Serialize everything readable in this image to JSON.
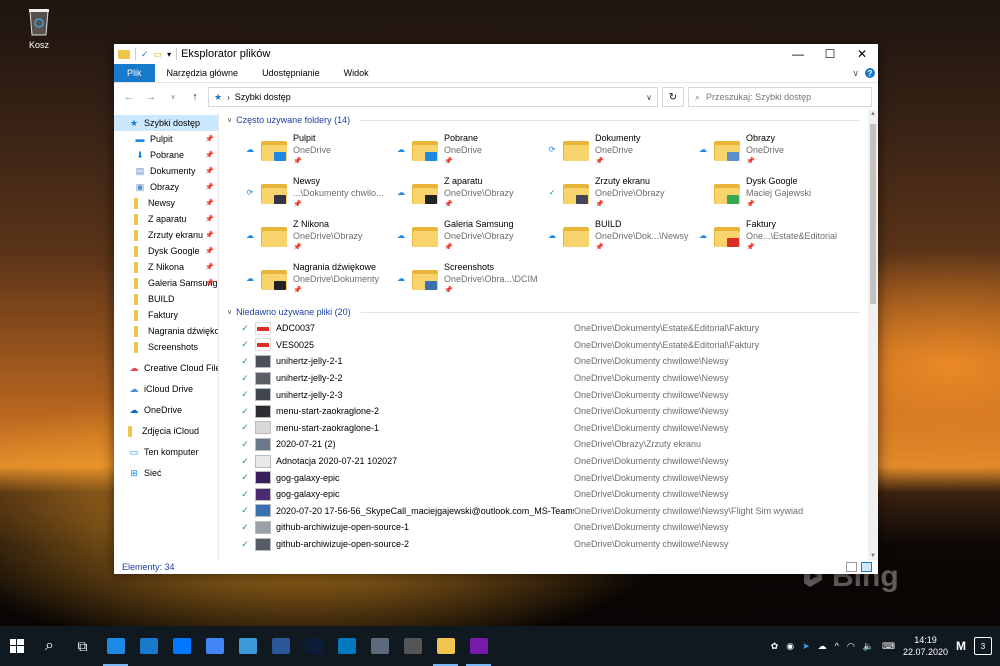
{
  "desktop": {
    "recycle_label": "Kosz",
    "watermark": "Bing"
  },
  "window": {
    "title": "Eksplorator plików",
    "ribbon_tabs": [
      "Plik",
      "Narzędzia główne",
      "Udostępnianie",
      "Widok"
    ],
    "address": "Szybki dostęp",
    "search_placeholder": "Przeszukaj: Szybki dostęp",
    "status_text": "Elementy: 34"
  },
  "nav": [
    {
      "label": "Szybki dostęp",
      "icon": "star-icon",
      "sel": true
    },
    {
      "label": "Pulpit",
      "icon": "desktop-icon",
      "pin": true
    },
    {
      "label": "Pobrane",
      "icon": "download-icon",
      "pin": true
    },
    {
      "label": "Dokumenty",
      "icon": "documents-icon",
      "pin": true
    },
    {
      "label": "Obrazy",
      "icon": "pictures-icon",
      "pin": true
    },
    {
      "label": "Newsy",
      "icon": "folder-icon",
      "pin": true
    },
    {
      "label": "Z aparatu",
      "icon": "folder-icon",
      "pin": true
    },
    {
      "label": "Zrzuty ekranu",
      "icon": "folder-icon",
      "pin": true
    },
    {
      "label": "Dysk Google",
      "icon": "folder-icon",
      "pin": true
    },
    {
      "label": "Z Nikona",
      "icon": "folder-icon",
      "pin": true
    },
    {
      "label": "Galeria Samsung",
      "icon": "folder-icon",
      "pin": true
    },
    {
      "label": "BUILD",
      "icon": "folder-icon"
    },
    {
      "label": "Faktury",
      "icon": "folder-icon"
    },
    {
      "label": "Nagrania dźwiękowe",
      "icon": "folder-icon"
    },
    {
      "label": "Screenshots",
      "icon": "folder-icon"
    },
    {
      "label": "Creative Cloud Files",
      "icon": "creative-cloud-icon",
      "top": true
    },
    {
      "label": "iCloud Drive",
      "icon": "icloud-icon",
      "top": true
    },
    {
      "label": "OneDrive",
      "icon": "onedrive-icon",
      "top": true
    },
    {
      "label": "Zdjęcia iCloud",
      "icon": "folder-icon",
      "top": true
    },
    {
      "label": "Ten komputer",
      "icon": "computer-icon",
      "top": true
    },
    {
      "label": "Sieć",
      "icon": "network-icon",
      "top": true
    }
  ],
  "frequent": {
    "header": "Często używane foldery (14)",
    "folders": [
      {
        "name": "Pulpit",
        "sub": "OneDrive",
        "status": "cloud",
        "badge": "#1e88e5"
      },
      {
        "name": "Pobrane",
        "sub": "OneDrive",
        "status": "cloud",
        "badge": "#1e88e5"
      },
      {
        "name": "Dokumenty",
        "sub": "OneDrive",
        "status": "sync",
        "badge": ""
      },
      {
        "name": "Obrazy",
        "sub": "OneDrive",
        "status": "cloud",
        "badge": "#5a8fc9"
      },
      {
        "name": "Newsy",
        "sub": "...\\Dokumenty chwilo...",
        "status": "sync",
        "badge": "#333344"
      },
      {
        "name": "Z aparatu",
        "sub": "OneDrive\\Obrazy",
        "status": "cloud",
        "badge": "#222222"
      },
      {
        "name": "Zrzuty ekranu",
        "sub": "OneDrive\\Obrazy",
        "status": "ok",
        "badge": "#444455"
      },
      {
        "name": "Dysk Google",
        "sub": "Maciej Gajewski",
        "status": "",
        "badge": "#34a853"
      },
      {
        "name": "Z Nikona",
        "sub": "OneDrive\\Obrazy",
        "status": "cloud",
        "badge": ""
      },
      {
        "name": "Galeria Samsung",
        "sub": "OneDrive\\Obrazy",
        "status": "cloud",
        "badge": ""
      },
      {
        "name": "BUILD",
        "sub": "OneDrive\\Dok...\\Newsy",
        "status": "cloud",
        "badge": ""
      },
      {
        "name": "Faktury",
        "sub": "One...\\Estate&Editorial",
        "status": "cloud",
        "badge": "#d93025"
      },
      {
        "name": "Nagrania dźwiękowe",
        "sub": "OneDrive\\Dokumenty",
        "status": "cloud",
        "badge": "#222222"
      },
      {
        "name": "Screenshots",
        "sub": "OneDrive\\Obra...\\DCIM",
        "status": "cloud",
        "badge": "#3a6fb0"
      }
    ]
  },
  "recent": {
    "header": "Niedawno używane pliki (20)",
    "files": [
      {
        "name": "ADC0037",
        "path": "OneDrive\\Dokumenty\\Estate&Editorial\\Faktury",
        "thumb": "pdf"
      },
      {
        "name": "VES0025",
        "path": "OneDrive\\Dokumenty\\Estate&Editorial\\Faktury",
        "thumb": "pdf"
      },
      {
        "name": "unihertz-jelly-2-1",
        "path": "OneDrive\\Dokumenty chwilowe\\Newsy",
        "thumb": "#4a4f5a"
      },
      {
        "name": "unihertz-jelly-2-2",
        "path": "OneDrive\\Dokumenty chwilowe\\Newsy",
        "thumb": "#5a5f66"
      },
      {
        "name": "unihertz-jelly-2-3",
        "path": "OneDrive\\Dokumenty chwilowe\\Newsy",
        "thumb": "#3f4550"
      },
      {
        "name": "menu-start-zaokraglone-2",
        "path": "OneDrive\\Dokumenty chwilowe\\Newsy",
        "thumb": "#2c2c34"
      },
      {
        "name": "menu-start-zaokraglone-1",
        "path": "OneDrive\\Dokumenty chwilowe\\Newsy",
        "thumb": "#d8d8d8"
      },
      {
        "name": "2020-07-21 (2)",
        "path": "OneDrive\\Obrazy\\Zrzuty ekranu",
        "thumb": "#6a7a8c"
      },
      {
        "name": "Adnotacja 2020-07-21 102027",
        "path": "OneDrive\\Dokumenty chwilowe\\Newsy",
        "thumb": "#e8e8e8"
      },
      {
        "name": "gog-galaxy-epic",
        "path": "OneDrive\\Dokumenty chwilowe\\Newsy",
        "thumb": "#3b1f5c"
      },
      {
        "name": "gog-galaxy-epic",
        "path": "OneDrive\\Dokumenty chwilowe\\Newsy",
        "thumb": "#4a2a70"
      },
      {
        "name": "2020-07-20 17-56-56_SkypeCall_maciejgajewski@outlook.com_MS-Teams-Mee...",
        "path": "OneDrive\\Dokumenty chwilowe\\Newsy\\Flight Sim wywiad",
        "thumb": "#3a6fb0"
      },
      {
        "name": "github-archiwizuje-open-source-1",
        "path": "OneDrive\\Dokumenty chwilowe\\Newsy",
        "thumb": "#9aa0a8"
      },
      {
        "name": "github-archiwizuje-open-source-2",
        "path": "OneDrive\\Dokumenty chwilowe\\Newsy",
        "thumb": "#555c66"
      }
    ]
  },
  "taskbar": {
    "apps": [
      {
        "name": "search-icon",
        "color": ""
      },
      {
        "name": "task-view-icon",
        "color": ""
      },
      {
        "name": "edge-icon",
        "color": "#1e88e5"
      },
      {
        "name": "mail-icon",
        "color": "#1979ca"
      },
      {
        "name": "messenger-icon",
        "color": "#0078ff"
      },
      {
        "name": "chrome-icon",
        "color": "#4285f4"
      },
      {
        "name": "phone-icon",
        "color": "#3a9ad9"
      },
      {
        "name": "word-icon",
        "color": "#2b579a"
      },
      {
        "name": "photoshop-icon",
        "color": "#0c1c34"
      },
      {
        "name": "trello-icon",
        "color": "#0079bf"
      },
      {
        "name": "translator-icon",
        "color": "#5b6b7b"
      },
      {
        "name": "calculator-icon",
        "color": "#555555"
      },
      {
        "name": "explorer-icon",
        "color": "#f1c44d"
      },
      {
        "name": "onenote-icon",
        "color": "#7719aa"
      }
    ],
    "time": "14:19",
    "date": "22.07.2020",
    "notifications": "3"
  }
}
